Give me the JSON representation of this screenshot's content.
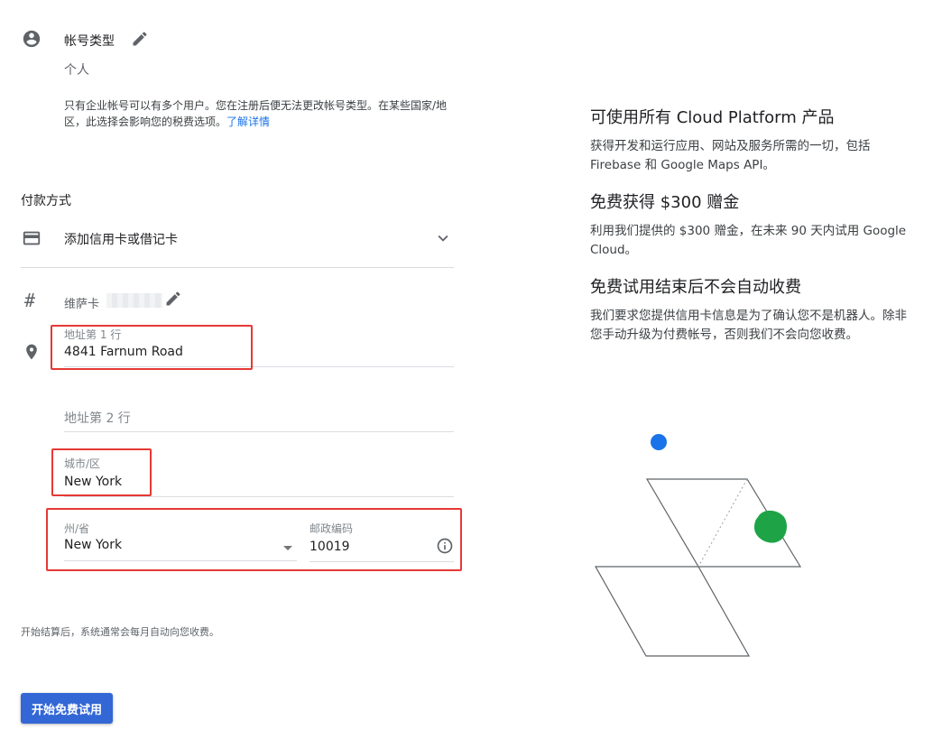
{
  "account": {
    "type_label": "帐号类型",
    "type_value": "个人",
    "note": "只有企业帐号可以有多个用户。您在注册后便无法更改帐号类型。在某些国家/地区，此选择会影响您的税费选项。",
    "note_link": "了解详情"
  },
  "payment": {
    "section_title": "付款方式",
    "add_card_label": "添加信用卡或借记卡",
    "card_label": "维萨卡",
    "address1_label": "地址第 1 行",
    "address1_value": "4841 Farnum Road",
    "address2_placeholder": "地址第 2 行",
    "city_label": "城市/区",
    "city_value": "New York",
    "state_label": "州/省",
    "state_value": "New York",
    "zip_label": "邮政编码",
    "zip_value": "10019"
  },
  "footer": {
    "billing_note": "开始结算后，系统通常会每月自动向您收费。",
    "start_button": "开始免费试用"
  },
  "benefits": [
    {
      "title": "可使用所有 Cloud Platform 产品",
      "text": "获得开发和运行应用、网站及服务所需的一切，包括 Firebase 和 Google Maps API。"
    },
    {
      "title": "免费获得 $300 赠金",
      "text": "利用我们提供的 $300 赠金，在未来 90 天内试用 Google Cloud。"
    },
    {
      "title": "免费试用结束后不会自动收费",
      "text": "我们要求您提供信用卡信息是为了确认您不是机器人。除非您手动升级为付费帐号，否则我们不会向您收费。"
    }
  ],
  "colors": {
    "accent": "#3367d6",
    "link": "#1a73e8",
    "highlight": "#e53935",
    "blue_dot": "#1a73e8",
    "green_blob": "#1ea446"
  },
  "icons": [
    "account-circle-icon",
    "edit-icon",
    "credit-card-icon",
    "chevron-down-icon",
    "hash-icon",
    "location-pin-icon",
    "dropdown-arrow-icon",
    "info-icon"
  ]
}
